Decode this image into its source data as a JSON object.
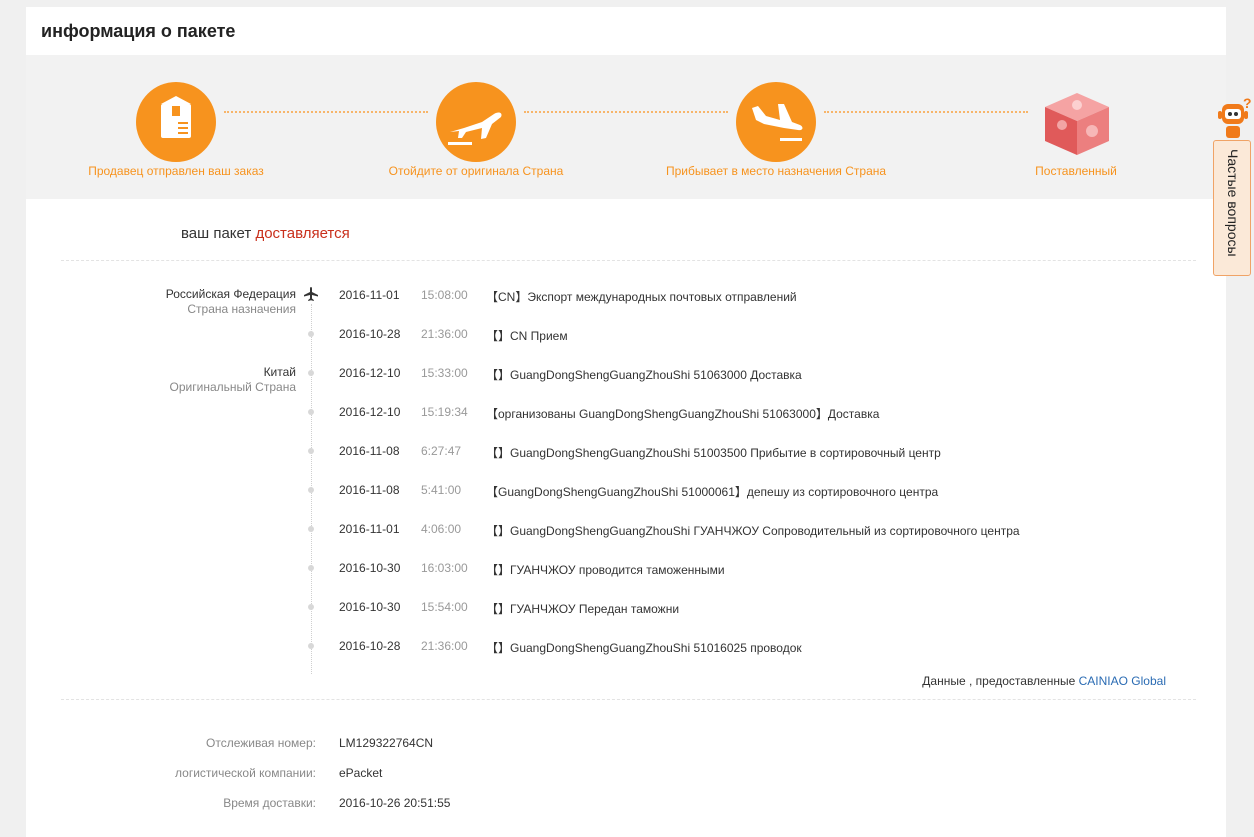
{
  "header": {
    "title": "информация о пакете"
  },
  "steps": [
    {
      "label": "Продавец отправлен ваш заказ",
      "icon": "package-icon"
    },
    {
      "label": "Отойдите от оригинала Страна",
      "icon": "plane-takeoff-icon"
    },
    {
      "label": "Прибывает в место назначения Страна",
      "icon": "plane-landing-icon"
    },
    {
      "label": "Поставленный",
      "icon": "cube-icon"
    }
  ],
  "status": {
    "prefix": "ваш пакет",
    "state": "доставляется"
  },
  "locations": [
    {
      "name": "Российская Федерация",
      "sub": "Страна назначения"
    },
    {
      "name": "Китай",
      "sub": "Оригинальный Страна"
    }
  ],
  "events": [
    {
      "date": "2016-11-01",
      "time": "15:08:00",
      "desc": "【CN】Экспорт международных почтовых отправлений"
    },
    {
      "date": "2016-10-28",
      "time": "21:36:00",
      "desc": "【】CN Прием"
    },
    {
      "date": "2016-12-10",
      "time": "15:33:00",
      "desc": "【】GuangDongShengGuangZhouShi 51063000 Доставка"
    },
    {
      "date": "2016-12-10",
      "time": "15:19:34",
      "desc": "【организованы GuangDongShengGuangZhouShi 51063000】Доставка"
    },
    {
      "date": "2016-11-08",
      "time": "6:27:47",
      "desc": "【】GuangDongShengGuangZhouShi 51003500 Прибытие в сортировочный центр"
    },
    {
      "date": "2016-11-08",
      "time": "5:41:00",
      "desc": "【GuangDongShengGuangZhouShi 51000061】депешу из сортировочного центра"
    },
    {
      "date": "2016-11-01",
      "time": "4:06:00",
      "desc": "【】GuangDongShengGuangZhouShi ГУАНЧЖОУ Сопроводительный из сортировочного центра"
    },
    {
      "date": "2016-10-30",
      "time": "16:03:00",
      "desc": "【】ГУАНЧЖОУ проводится таможенными"
    },
    {
      "date": "2016-10-30",
      "time": "15:54:00",
      "desc": "【】ГУАНЧЖОУ Передан таможни"
    },
    {
      "date": "2016-10-28",
      "time": "21:36:00",
      "desc": "【】GuangDongShengGuangZhouShi 51016025 проводок"
    }
  ],
  "source": {
    "text": "Данные , предоставленные",
    "link": "CAINIAO Global"
  },
  "info": [
    {
      "label": "Отслеживая номер:",
      "value": "LM129322764CN"
    },
    {
      "label": "логистической компании:",
      "value": "ePacket"
    },
    {
      "label": "Время доставки:",
      "value": "2016-10-26 20:51:55"
    }
  ],
  "help": {
    "label": "Частые вопросы",
    "badge": "?"
  },
  "colors": {
    "accent": "#f7931e",
    "status": "#c9301c",
    "link": "#2a6bb3"
  }
}
